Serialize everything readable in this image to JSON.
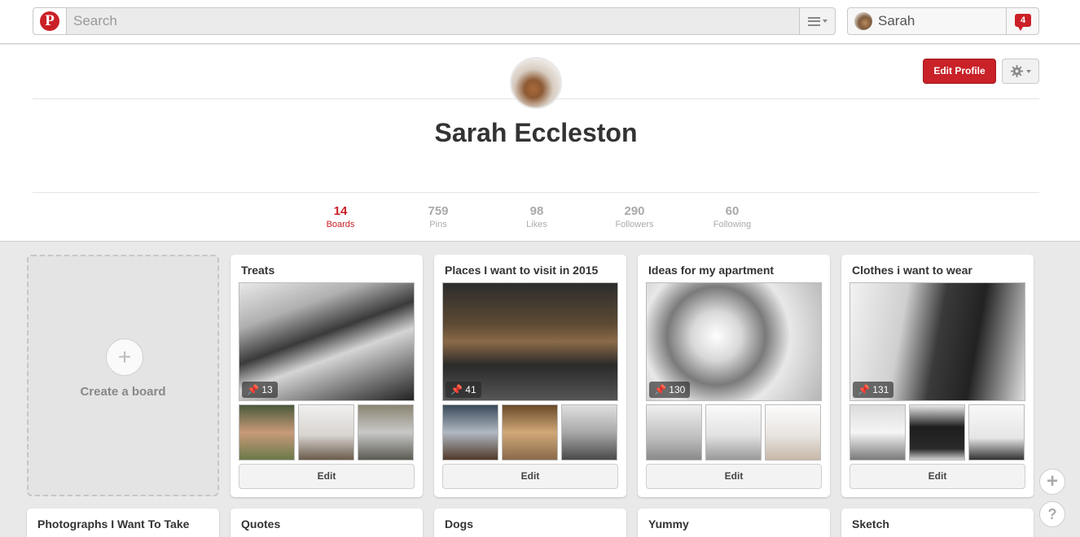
{
  "topbar": {
    "logo": "P",
    "search_placeholder": "Search",
    "user_name": "Sarah",
    "notification_count": "4"
  },
  "profile": {
    "edit_button": "Edit Profile",
    "name": "Sarah Eccleston",
    "stats": [
      {
        "value": "14",
        "label": "Boards",
        "active": true
      },
      {
        "value": "759",
        "label": "Pins"
      },
      {
        "value": "98",
        "label": "Likes"
      },
      {
        "value": "290",
        "label": "Followers"
      },
      {
        "value": "60",
        "label": "Following"
      }
    ]
  },
  "create_board": {
    "icon": "+",
    "label": "Create a board"
  },
  "boards": [
    {
      "title": "Treats",
      "pins": "13",
      "edit": "Edit"
    },
    {
      "title": "Places I want to visit in 2015",
      "pins": "41",
      "edit": "Edit"
    },
    {
      "title": "Ideas for my apartment",
      "pins": "130",
      "edit": "Edit"
    },
    {
      "title": "Clothes i want to wear",
      "pins": "131",
      "edit": "Edit"
    }
  ],
  "boards_row2": [
    {
      "title": "Photographs I Want To Take"
    },
    {
      "title": "Quotes"
    },
    {
      "title": "Dogs"
    },
    {
      "title": "Yummy"
    },
    {
      "title": "Sketch"
    }
  ],
  "floating": {
    "add": "+",
    "help": "?"
  },
  "colors": {
    "brand": "#cb2027",
    "background": "#e9e9e9"
  },
  "icons": [
    "pinterest-logo-icon",
    "menu-icon",
    "notification-icon",
    "gear-icon",
    "plus-icon",
    "pin-icon",
    "help-icon"
  ]
}
